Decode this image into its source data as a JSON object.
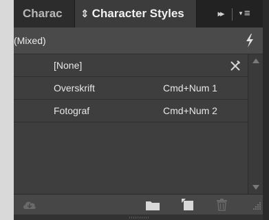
{
  "tabs": {
    "inactive_label": "Charac",
    "active_label": "Character Styles",
    "active_arrows": "⇕",
    "collapse_glyph": "▸▸",
    "menu_glyph": "≡"
  },
  "header": {
    "label": "(Mixed)",
    "icon": "lightning-icon"
  },
  "styles": [
    {
      "name": "[None]",
      "shortcut": "",
      "icon": "clear-override-icon"
    },
    {
      "name": "Overskrift",
      "shortcut": "Cmd+Num 1"
    },
    {
      "name": "Fotograf",
      "shortcut": "Cmd+Num 2"
    }
  ],
  "toolbar": {
    "icons": [
      "cloud-icon",
      "folder-icon",
      "new-style-icon",
      "trash-icon"
    ]
  },
  "colors": {
    "panel": "#424242",
    "tabbar": "#222222",
    "text": "#e8e8e8"
  }
}
